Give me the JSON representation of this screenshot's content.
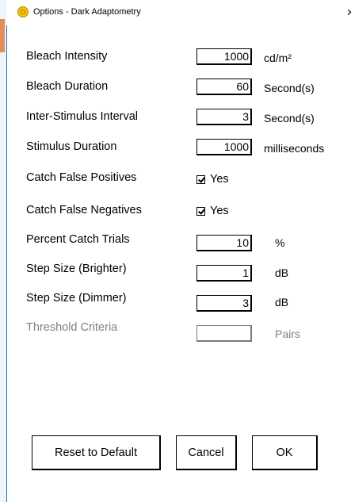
{
  "window": {
    "title": "Options - Dark Adaptometry",
    "close_glyph": "×",
    "app_icon": "dark-adaptometry-app-icon"
  },
  "rows": [
    {
      "label": "Bleach Intensity",
      "value": "1000",
      "unit": "cd/m²"
    },
    {
      "label": "Bleach Duration",
      "value": "60",
      "unit": "Second(s)"
    },
    {
      "label": "Inter-Stimulus Interval",
      "value": "3",
      "unit": "Second(s)"
    },
    {
      "label": "Stimulus Duration",
      "value": "1000",
      "unit": "milliseconds"
    },
    {
      "label": "Catch False Positives",
      "checked": true,
      "check_label": "Yes"
    },
    {
      "label": "Catch False Negatives",
      "checked": true,
      "check_label": "Yes"
    },
    {
      "label": "Percent Catch Trials",
      "value": "10",
      "unit": "%"
    },
    {
      "label": "Step Size (Brighter)",
      "value": "1",
      "unit": "dB"
    },
    {
      "label": "Step Size (Dimmer)",
      "value": "3",
      "unit": "dB"
    },
    {
      "label": "Threshold Criteria",
      "value": "",
      "unit": "Pairs",
      "disabled": true
    }
  ],
  "buttons": {
    "reset": "Reset to Default",
    "cancel": "Cancel",
    "ok": "OK"
  },
  "colors": {
    "disabled_text": "#808080",
    "window_border": "#2b6cc4"
  }
}
